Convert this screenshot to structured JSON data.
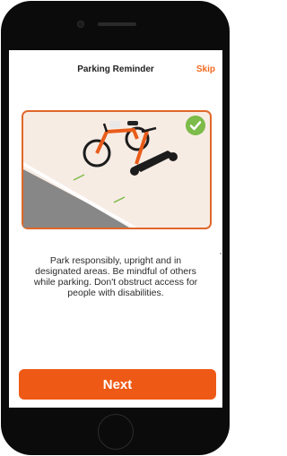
{
  "header": {
    "title": "Parking Reminder",
    "skip_label": "Skip"
  },
  "illustration": {
    "name": "parking-illustration",
    "status": "check-circle-icon"
  },
  "content": {
    "message": "Park responsibly, upright and in designated areas. Be mindful of others while parking. Don't obstruct access for people with disabilities."
  },
  "actions": {
    "next_label": "Next"
  },
  "colors": {
    "accent": "#ee5a16",
    "success": "#7dbb4a",
    "scene_bg": "#f6ebe3",
    "scene_border": "#e0672a"
  }
}
